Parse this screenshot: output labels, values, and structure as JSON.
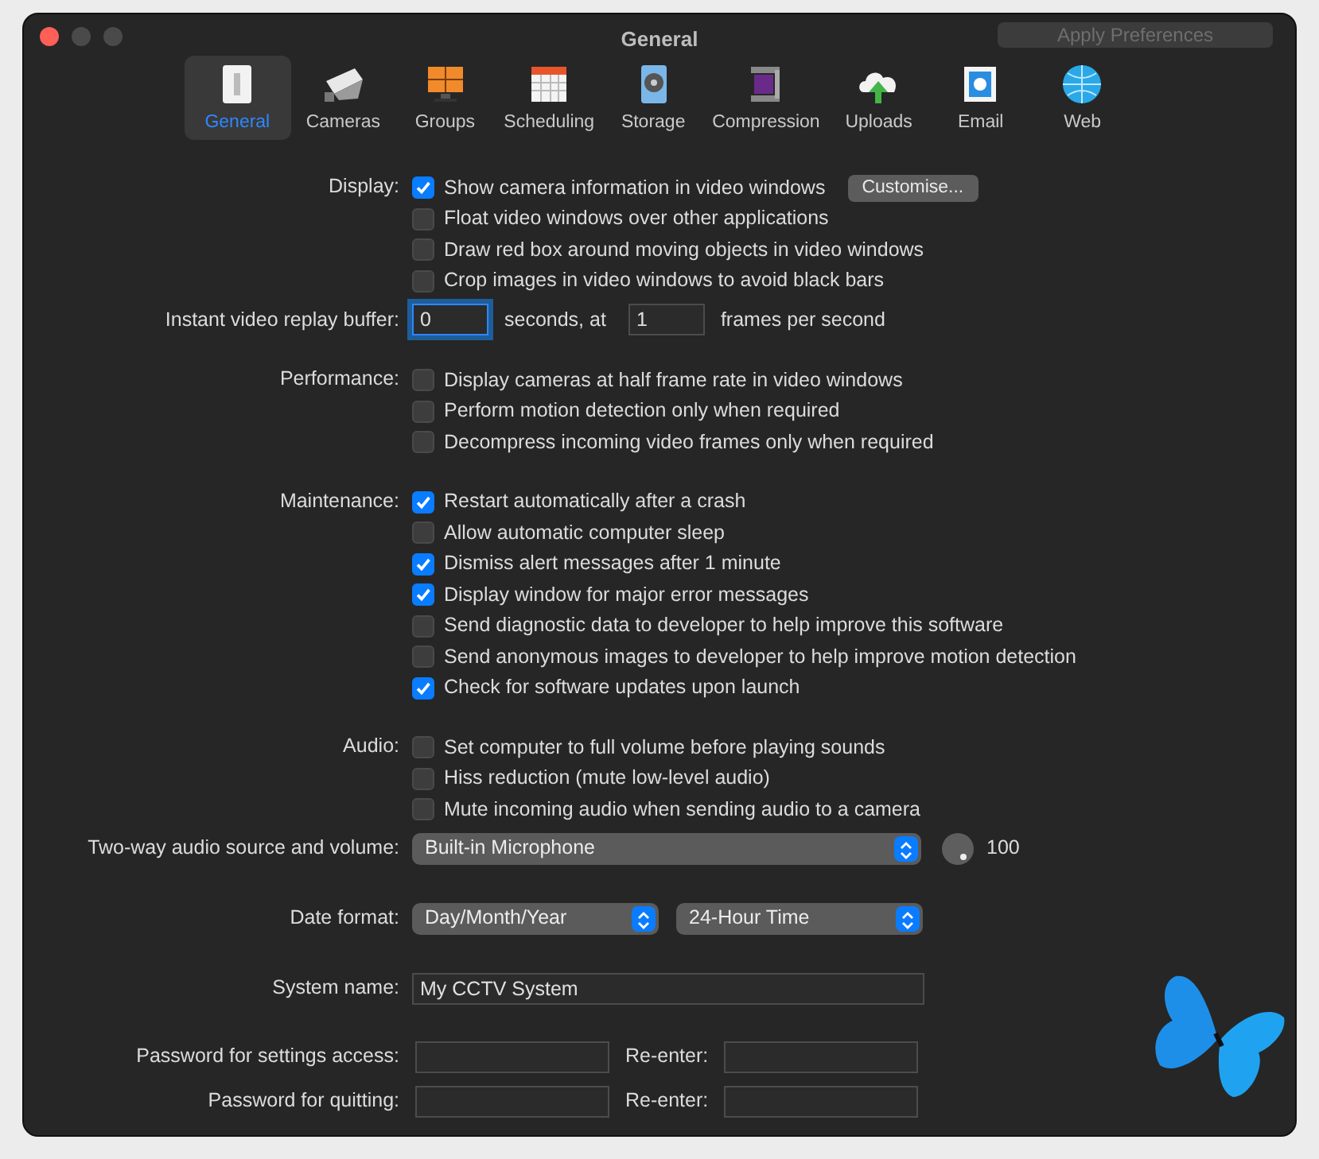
{
  "window": {
    "title": "General"
  },
  "apply_button": {
    "label": "Apply Preferences",
    "disabled": true
  },
  "toolbar": [
    {
      "label": "General",
      "kind": "switch",
      "selected": true
    },
    {
      "label": "Cameras",
      "kind": "camera",
      "selected": false
    },
    {
      "label": "Groups",
      "kind": "grid",
      "selected": false
    },
    {
      "label": "Scheduling",
      "kind": "calendar",
      "selected": false
    },
    {
      "label": "Storage",
      "kind": "disk",
      "selected": false
    },
    {
      "label": "Compression",
      "kind": "clamp",
      "selected": false
    },
    {
      "label": "Uploads",
      "kind": "cloud",
      "selected": false
    },
    {
      "label": "Email",
      "kind": "stamp",
      "selected": false
    },
    {
      "label": "Web",
      "kind": "globe",
      "selected": false
    }
  ],
  "sections": [
    {
      "kind": "checks",
      "label": "Display:",
      "options": [
        {
          "label": "Show camera information in video windows",
          "checked": true,
          "button": "Customise..."
        },
        {
          "label": "Float video windows over other applications",
          "checked": false
        },
        {
          "label": "Draw red box around moving objects in video windows",
          "checked": false
        },
        {
          "label": "Crop images in video windows to avoid black bars",
          "checked": false
        }
      ]
    },
    {
      "kind": "replay",
      "label": "Instant video replay buffer:",
      "seconds": "0",
      "focused": true,
      "seconds_unit": "seconds, at",
      "fps": "1",
      "fps_unit": "frames per second"
    },
    {
      "kind": "checks",
      "label": "Performance:",
      "options": [
        {
          "label": "Display cameras at half frame rate in video windows",
          "checked": false
        },
        {
          "label": "Perform motion detection only when required",
          "checked": false
        },
        {
          "label": "Decompress incoming video frames only when required",
          "checked": false
        }
      ]
    },
    {
      "kind": "checks",
      "label": "Maintenance:",
      "options": [
        {
          "label": "Restart automatically after a crash",
          "checked": true
        },
        {
          "label": "Allow automatic computer sleep",
          "checked": false
        },
        {
          "label": "Dismiss alert messages after 1 minute",
          "checked": true
        },
        {
          "label": "Display window for major error messages",
          "checked": true
        },
        {
          "label": "Send diagnostic data to developer to help improve this software",
          "checked": false
        },
        {
          "label": "Send anonymous images to developer to help improve motion detection",
          "checked": false
        },
        {
          "label": "Check for software updates upon launch",
          "checked": true
        }
      ]
    },
    {
      "kind": "checks",
      "label": "Audio:",
      "options": [
        {
          "label": "Set computer to full volume before playing sounds",
          "checked": false
        },
        {
          "label": "Hiss reduction (mute low-level audio)",
          "checked": false
        },
        {
          "label": "Mute incoming audio when sending audio to a camera",
          "checked": false
        }
      ]
    },
    {
      "kind": "selects",
      "label": "Two-way audio source and volume:",
      "selects": [
        "Built-in Microphone"
      ],
      "volume": "100"
    },
    {
      "kind": "selects",
      "label": "Date format:",
      "selects": [
        "Day/Month/Year",
        "24-Hour Time"
      ]
    },
    {
      "kind": "text",
      "label": "System name:",
      "value": "My CCTV System"
    },
    {
      "kind": "password",
      "label": "Password for settings access:",
      "reenter": "Re-enter:"
    },
    {
      "kind": "password",
      "label": "Password for quitting:",
      "reenter": "Re-enter:"
    }
  ]
}
